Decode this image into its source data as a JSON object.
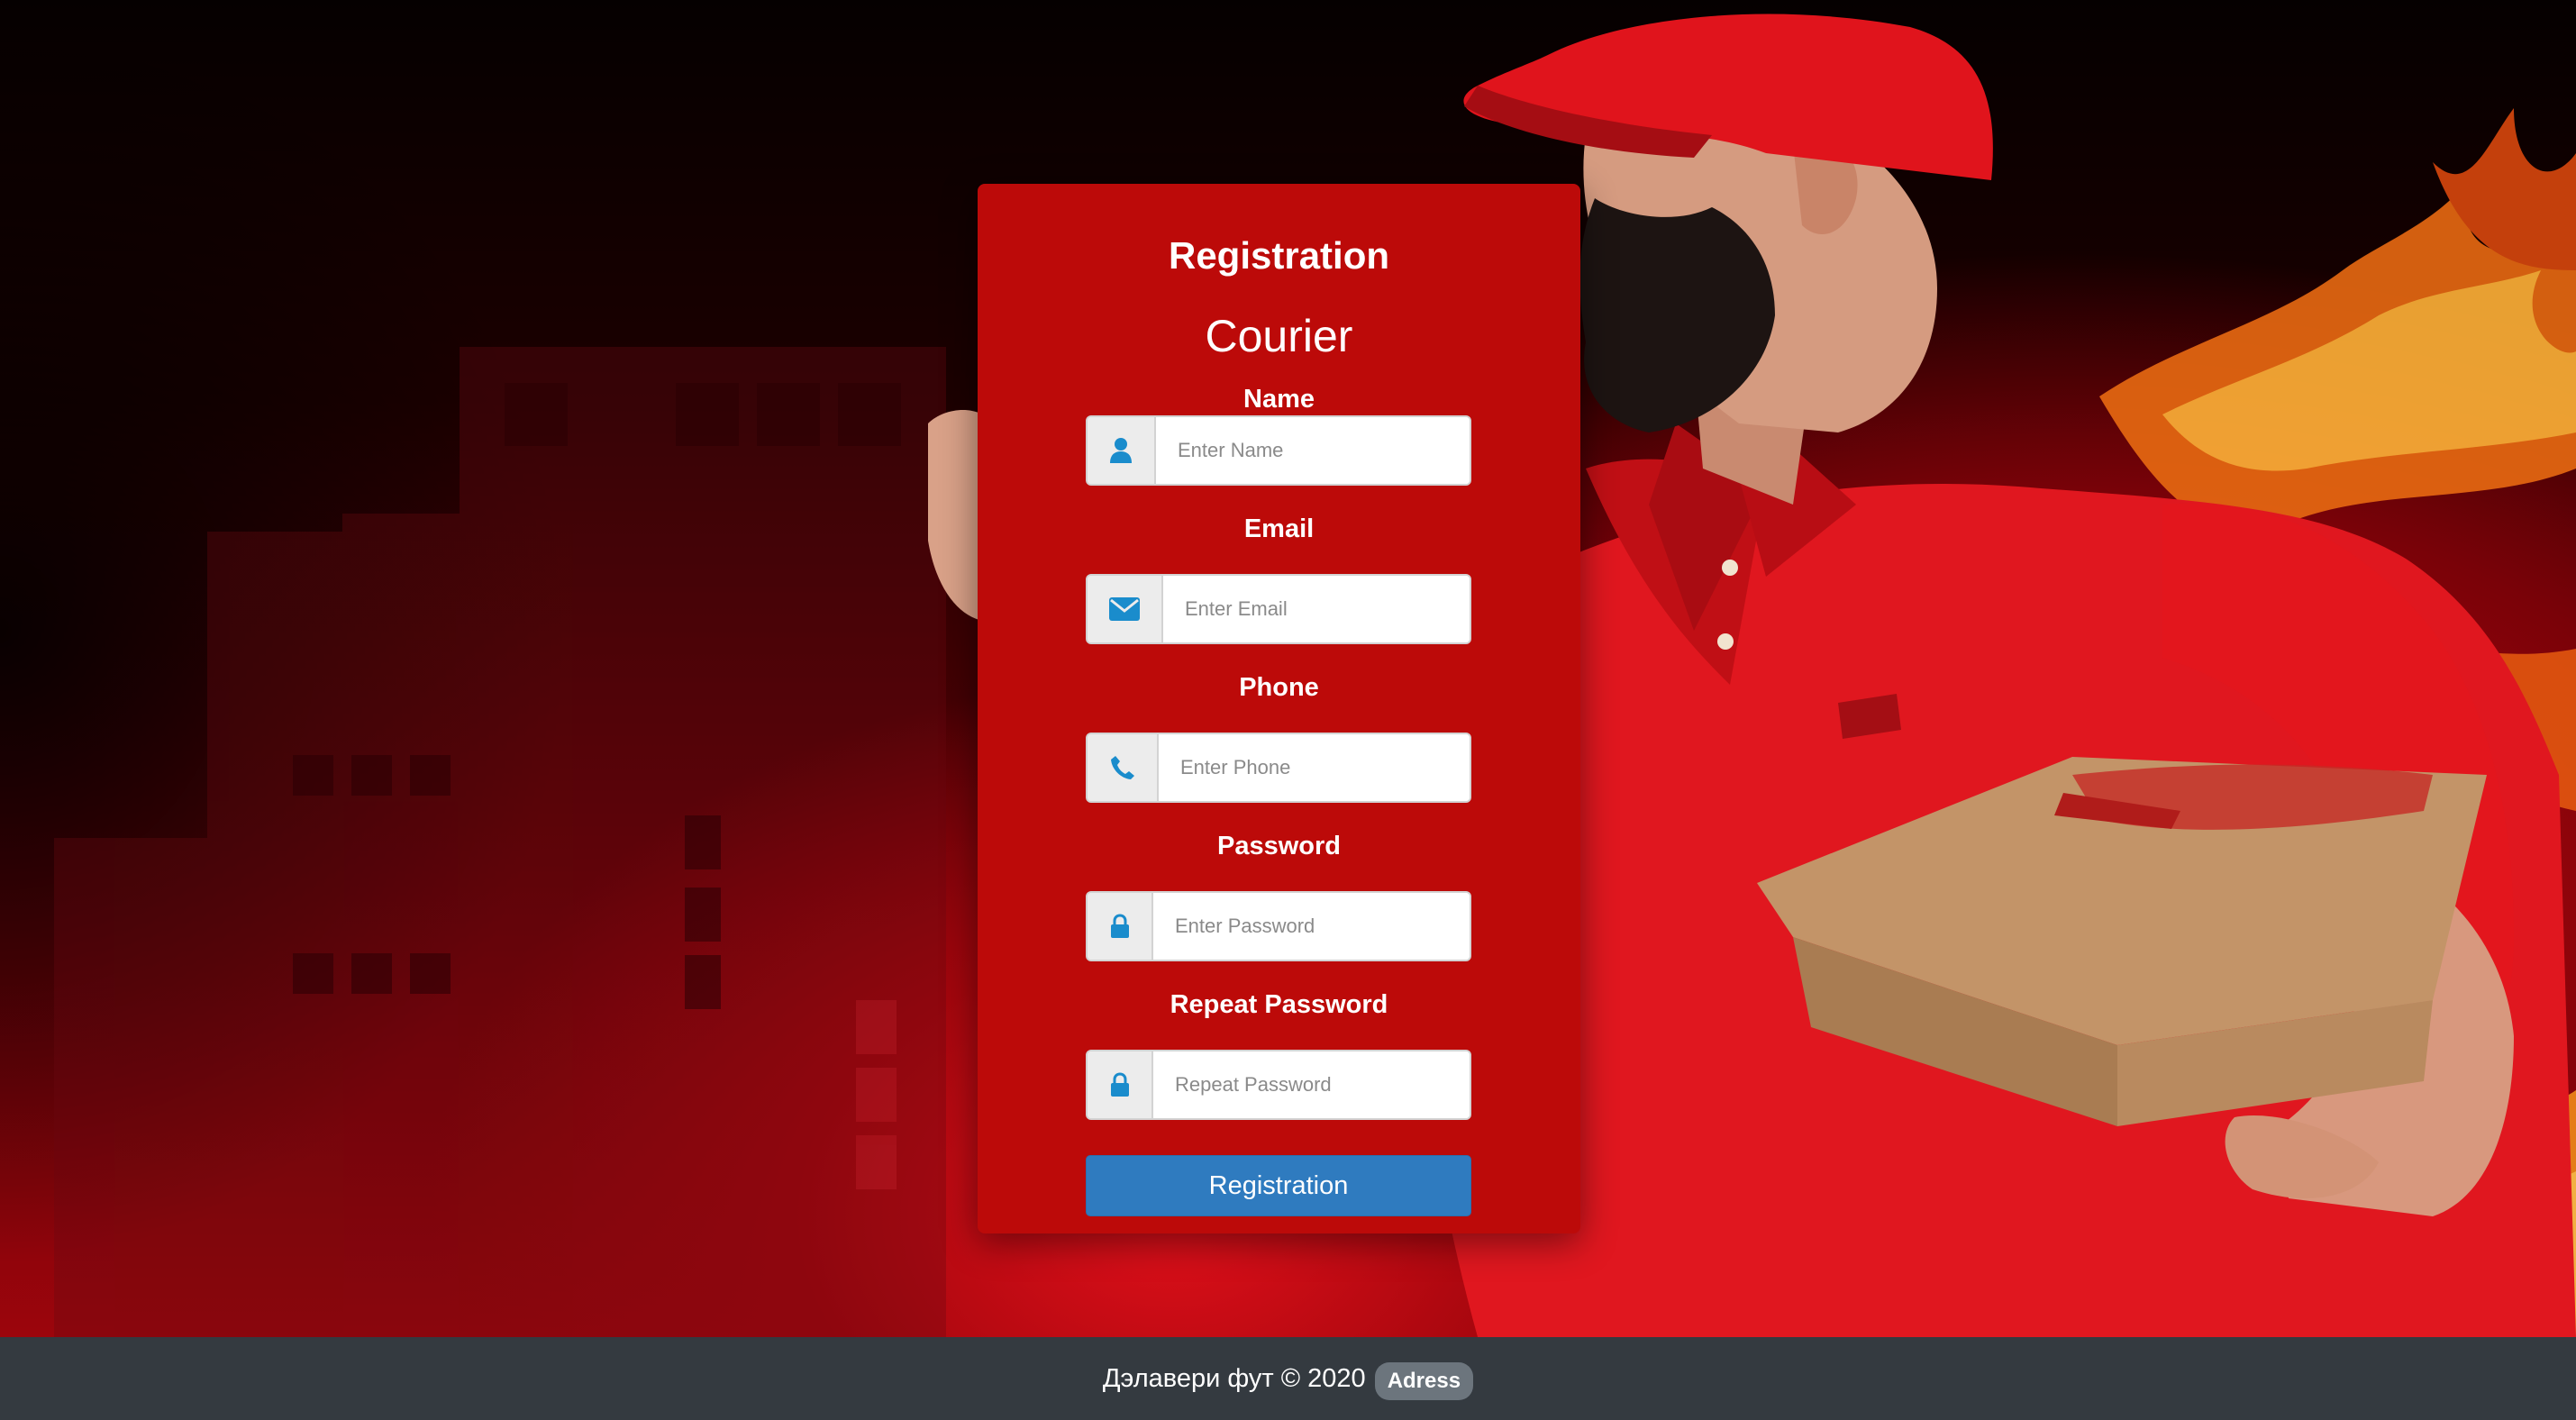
{
  "form": {
    "title": "Registration",
    "subtitle": "Courier",
    "fields": [
      {
        "label": "Name",
        "placeholder": "Enter Name",
        "icon": "user-icon"
      },
      {
        "label": "Email",
        "placeholder": "Enter Email",
        "icon": "envelope-icon"
      },
      {
        "label": "Phone",
        "placeholder": "Enter Phone",
        "icon": "phone-icon"
      },
      {
        "label": "Password",
        "placeholder": "Enter Password",
        "icon": "lock-icon"
      },
      {
        "label": "Repeat Password",
        "placeholder": "Repeat Password",
        "icon": "lock-icon"
      }
    ],
    "submit_label": "Registration"
  },
  "footer": {
    "copyright": "Дэлавери фут © 2020",
    "badge": "Adress"
  },
  "colors": {
    "card_bg": "#bc0a09",
    "button_bg": "#2f7bbf",
    "icon_color": "#1a8ccc",
    "footer_bg": "#343a40",
    "badge_bg": "#6c757d"
  }
}
